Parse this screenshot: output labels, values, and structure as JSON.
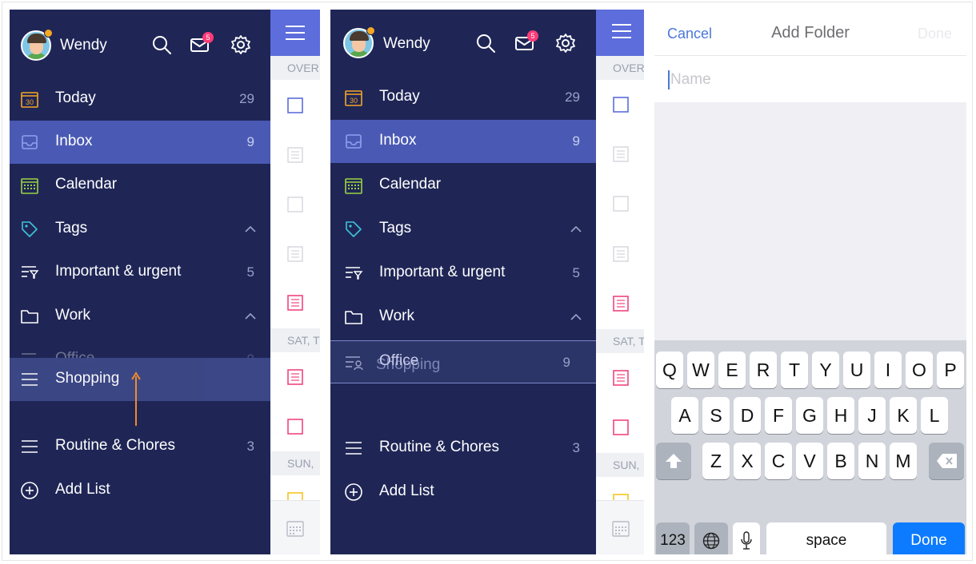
{
  "user": {
    "name": "Wendy",
    "unread_mail": "5"
  },
  "sidebar": {
    "rows": [
      {
        "label": "Today",
        "count": "29"
      },
      {
        "label": "Inbox",
        "count": "9"
      },
      {
        "label": "Calendar"
      },
      {
        "label": "Tags"
      },
      {
        "label": "Important & urgent",
        "count": "5"
      },
      {
        "label": "Work"
      },
      {
        "label": "Office",
        "count": "9"
      },
      {
        "label": "Shopping"
      },
      {
        "label": "Routine & Chores",
        "count": "3"
      },
      {
        "label": "Add List"
      }
    ],
    "today_icon_day": "30"
  },
  "peek": {
    "sections": [
      "OVER",
      "SAT, T",
      "SUN,"
    ],
    "sections_right": [
      "OVER",
      "SAT, T",
      "SUN,"
    ]
  },
  "add_folder": {
    "cancel_label": "Cancel",
    "title": "Add Folder",
    "done_label": "Done",
    "name_placeholder": "Name"
  },
  "keyboard": {
    "row1": [
      "Q",
      "W",
      "E",
      "R",
      "T",
      "Y",
      "U",
      "I",
      "O",
      "P"
    ],
    "row2": [
      "A",
      "S",
      "D",
      "F",
      "G",
      "H",
      "J",
      "K",
      "L"
    ],
    "row3": [
      "Z",
      "X",
      "C",
      "V",
      "B",
      "N",
      "M"
    ],
    "numbers_label": "123",
    "space_label": "space",
    "done_label": "Done"
  },
  "colors": {
    "sidebar_bg": "#1f2656",
    "active_row": "#4a5ab4",
    "header_blue": "#5d6ddc",
    "badge_pink": "#ff3b78",
    "ios_blue": "#0d7bff"
  }
}
